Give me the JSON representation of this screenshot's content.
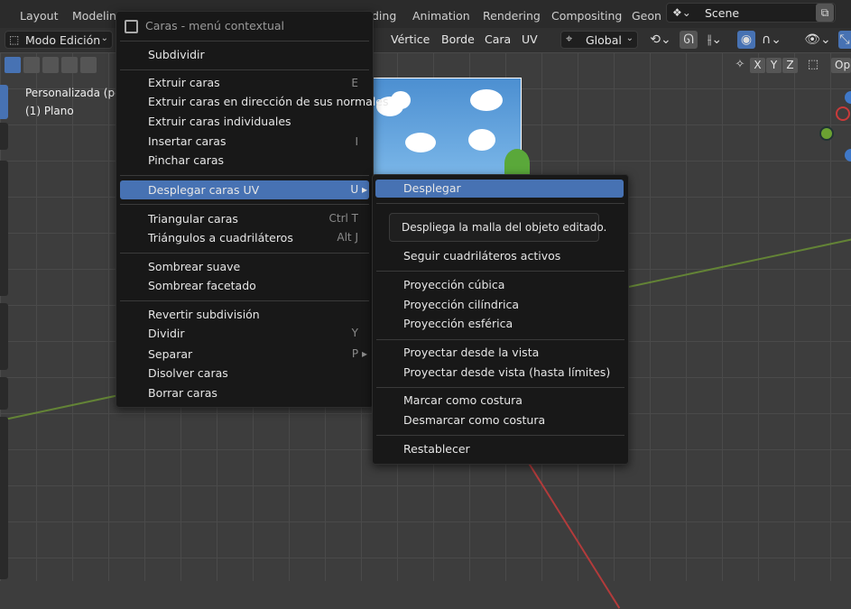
{
  "workspace_tabs": [
    "Layout",
    "Modeling",
    "ding",
    "Animation",
    "Rendering",
    "Compositing",
    "Geon"
  ],
  "scene": {
    "label": "Scene"
  },
  "header": {
    "mode": "Modo Edición",
    "menus": [
      "Vértice",
      "Borde",
      "Cara",
      "UV"
    ],
    "orientation": "Global"
  },
  "axes_buttons": [
    "X",
    "Y",
    "Z"
  ],
  "options_label": "Op",
  "viewport": {
    "overlay_line1": "Personalizada (per",
    "overlay_line2": "(1) Plano"
  },
  "context_menu": {
    "title": "Caras - menú contextual",
    "items": [
      {
        "label": "Subdividir",
        "shortcut": ""
      },
      {
        "label": "Extruir caras",
        "shortcut": "E"
      },
      {
        "label": "Extruir caras en dirección de sus normales",
        "shortcut": ""
      },
      {
        "label": "Extruir caras individuales",
        "shortcut": ""
      },
      {
        "label": "Insertar caras",
        "shortcut": "I"
      },
      {
        "label": "Pinchar caras",
        "shortcut": ""
      },
      {
        "label": "Desplegar caras UV",
        "shortcut": "U ▸"
      },
      {
        "label": "Triangular caras",
        "shortcut": "Ctrl T"
      },
      {
        "label": "Triángulos a cuadriláteros",
        "shortcut": "Alt J"
      },
      {
        "label": "Sombrear suave",
        "shortcut": ""
      },
      {
        "label": "Sombrear facetado",
        "shortcut": ""
      },
      {
        "label": "Revertir subdivisión",
        "shortcut": ""
      },
      {
        "label": "Dividir",
        "shortcut": "Y"
      },
      {
        "label": "Separar",
        "shortcut": "P ▸"
      },
      {
        "label": "Disolver caras",
        "shortcut": ""
      },
      {
        "label": "Borrar caras",
        "shortcut": ""
      }
    ]
  },
  "submenu": {
    "items": [
      "Desplegar",
      "Seguir cuadriláteros activos",
      "Proyección cúbica",
      "Proyección cilíndrica",
      "Proyección esférica",
      "Proyectar desde la vista",
      "Proyectar desde vista (hasta límites)",
      "Marcar como costura",
      "Desmarcar como costura",
      "Restablecer"
    ]
  },
  "tooltip": "Despliega la malla del objeto editado.",
  "colors": {
    "accent": "#4772b3",
    "menu_bg": "#181818"
  }
}
